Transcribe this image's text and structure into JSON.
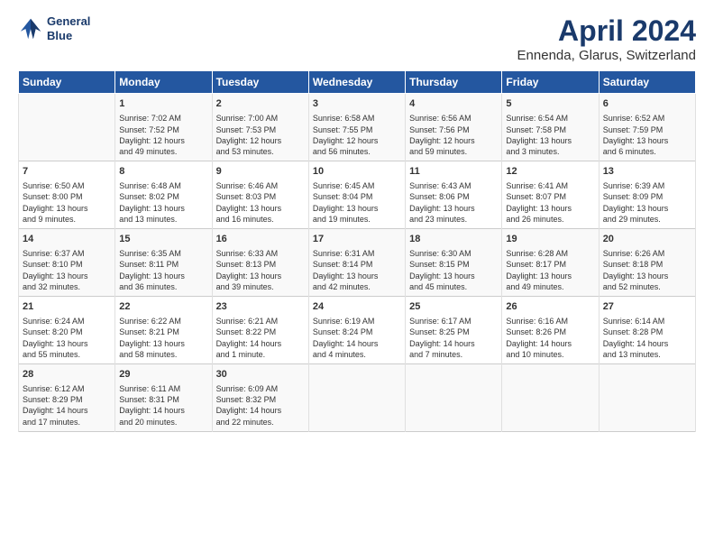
{
  "header": {
    "logo_line1": "General",
    "logo_line2": "Blue",
    "month": "April 2024",
    "location": "Ennenda, Glarus, Switzerland"
  },
  "days_of_week": [
    "Sunday",
    "Monday",
    "Tuesday",
    "Wednesday",
    "Thursday",
    "Friday",
    "Saturday"
  ],
  "weeks": [
    [
      {
        "day": "",
        "content": ""
      },
      {
        "day": "1",
        "content": "Sunrise: 7:02 AM\nSunset: 7:52 PM\nDaylight: 12 hours\nand 49 minutes."
      },
      {
        "day": "2",
        "content": "Sunrise: 7:00 AM\nSunset: 7:53 PM\nDaylight: 12 hours\nand 53 minutes."
      },
      {
        "day": "3",
        "content": "Sunrise: 6:58 AM\nSunset: 7:55 PM\nDaylight: 12 hours\nand 56 minutes."
      },
      {
        "day": "4",
        "content": "Sunrise: 6:56 AM\nSunset: 7:56 PM\nDaylight: 12 hours\nand 59 minutes."
      },
      {
        "day": "5",
        "content": "Sunrise: 6:54 AM\nSunset: 7:58 PM\nDaylight: 13 hours\nand 3 minutes."
      },
      {
        "day": "6",
        "content": "Sunrise: 6:52 AM\nSunset: 7:59 PM\nDaylight: 13 hours\nand 6 minutes."
      }
    ],
    [
      {
        "day": "7",
        "content": "Sunrise: 6:50 AM\nSunset: 8:00 PM\nDaylight: 13 hours\nand 9 minutes."
      },
      {
        "day": "8",
        "content": "Sunrise: 6:48 AM\nSunset: 8:02 PM\nDaylight: 13 hours\nand 13 minutes."
      },
      {
        "day": "9",
        "content": "Sunrise: 6:46 AM\nSunset: 8:03 PM\nDaylight: 13 hours\nand 16 minutes."
      },
      {
        "day": "10",
        "content": "Sunrise: 6:45 AM\nSunset: 8:04 PM\nDaylight: 13 hours\nand 19 minutes."
      },
      {
        "day": "11",
        "content": "Sunrise: 6:43 AM\nSunset: 8:06 PM\nDaylight: 13 hours\nand 23 minutes."
      },
      {
        "day": "12",
        "content": "Sunrise: 6:41 AM\nSunset: 8:07 PM\nDaylight: 13 hours\nand 26 minutes."
      },
      {
        "day": "13",
        "content": "Sunrise: 6:39 AM\nSunset: 8:09 PM\nDaylight: 13 hours\nand 29 minutes."
      }
    ],
    [
      {
        "day": "14",
        "content": "Sunrise: 6:37 AM\nSunset: 8:10 PM\nDaylight: 13 hours\nand 32 minutes."
      },
      {
        "day": "15",
        "content": "Sunrise: 6:35 AM\nSunset: 8:11 PM\nDaylight: 13 hours\nand 36 minutes."
      },
      {
        "day": "16",
        "content": "Sunrise: 6:33 AM\nSunset: 8:13 PM\nDaylight: 13 hours\nand 39 minutes."
      },
      {
        "day": "17",
        "content": "Sunrise: 6:31 AM\nSunset: 8:14 PM\nDaylight: 13 hours\nand 42 minutes."
      },
      {
        "day": "18",
        "content": "Sunrise: 6:30 AM\nSunset: 8:15 PM\nDaylight: 13 hours\nand 45 minutes."
      },
      {
        "day": "19",
        "content": "Sunrise: 6:28 AM\nSunset: 8:17 PM\nDaylight: 13 hours\nand 49 minutes."
      },
      {
        "day": "20",
        "content": "Sunrise: 6:26 AM\nSunset: 8:18 PM\nDaylight: 13 hours\nand 52 minutes."
      }
    ],
    [
      {
        "day": "21",
        "content": "Sunrise: 6:24 AM\nSunset: 8:20 PM\nDaylight: 13 hours\nand 55 minutes."
      },
      {
        "day": "22",
        "content": "Sunrise: 6:22 AM\nSunset: 8:21 PM\nDaylight: 13 hours\nand 58 minutes."
      },
      {
        "day": "23",
        "content": "Sunrise: 6:21 AM\nSunset: 8:22 PM\nDaylight: 14 hours\nand 1 minute."
      },
      {
        "day": "24",
        "content": "Sunrise: 6:19 AM\nSunset: 8:24 PM\nDaylight: 14 hours\nand 4 minutes."
      },
      {
        "day": "25",
        "content": "Sunrise: 6:17 AM\nSunset: 8:25 PM\nDaylight: 14 hours\nand 7 minutes."
      },
      {
        "day": "26",
        "content": "Sunrise: 6:16 AM\nSunset: 8:26 PM\nDaylight: 14 hours\nand 10 minutes."
      },
      {
        "day": "27",
        "content": "Sunrise: 6:14 AM\nSunset: 8:28 PM\nDaylight: 14 hours\nand 13 minutes."
      }
    ],
    [
      {
        "day": "28",
        "content": "Sunrise: 6:12 AM\nSunset: 8:29 PM\nDaylight: 14 hours\nand 17 minutes."
      },
      {
        "day": "29",
        "content": "Sunrise: 6:11 AM\nSunset: 8:31 PM\nDaylight: 14 hours\nand 20 minutes."
      },
      {
        "day": "30",
        "content": "Sunrise: 6:09 AM\nSunset: 8:32 PM\nDaylight: 14 hours\nand 22 minutes."
      },
      {
        "day": "",
        "content": ""
      },
      {
        "day": "",
        "content": ""
      },
      {
        "day": "",
        "content": ""
      },
      {
        "day": "",
        "content": ""
      }
    ]
  ]
}
